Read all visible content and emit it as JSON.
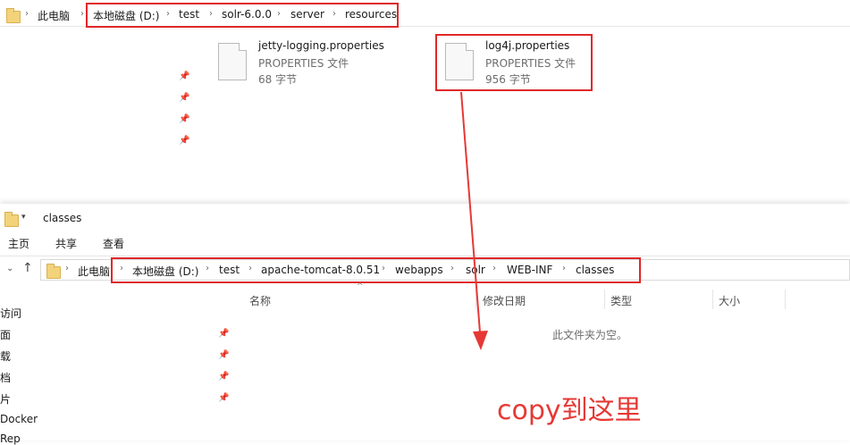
{
  "top_window": {
    "address_bar": {
      "crumbs": [
        "此电脑",
        "本地磁盘 (D:)",
        "test",
        "solr-6.0.0",
        "server",
        "resources"
      ]
    },
    "files": [
      {
        "name": "jetty-logging.properties",
        "type": "PROPERTIES 文件",
        "size": "68 字节"
      },
      {
        "name": "log4j.properties",
        "type": "PROPERTIES 文件",
        "size": "956 字节"
      }
    ]
  },
  "bottom_window": {
    "title": "classes",
    "ribbon": [
      "主页",
      "共享",
      "查看"
    ],
    "address_bar": {
      "crumbs": [
        "此电脑",
        "本地磁盘 (D:)",
        "test",
        "apache-tomcat-8.0.51",
        "webapps",
        "solr",
        "WEB-INF",
        "classes"
      ]
    },
    "columns": [
      "名称",
      "修改日期",
      "类型",
      "大小"
    ],
    "empty_message": "此文件夹为空。",
    "nav_items": [
      "速访问",
      "桌面",
      "下载",
      "文档",
      "图片",
      "Docker",
      "Rep"
    ]
  },
  "annotation": {
    "text": "copy到这里",
    "color": "#e53935"
  }
}
